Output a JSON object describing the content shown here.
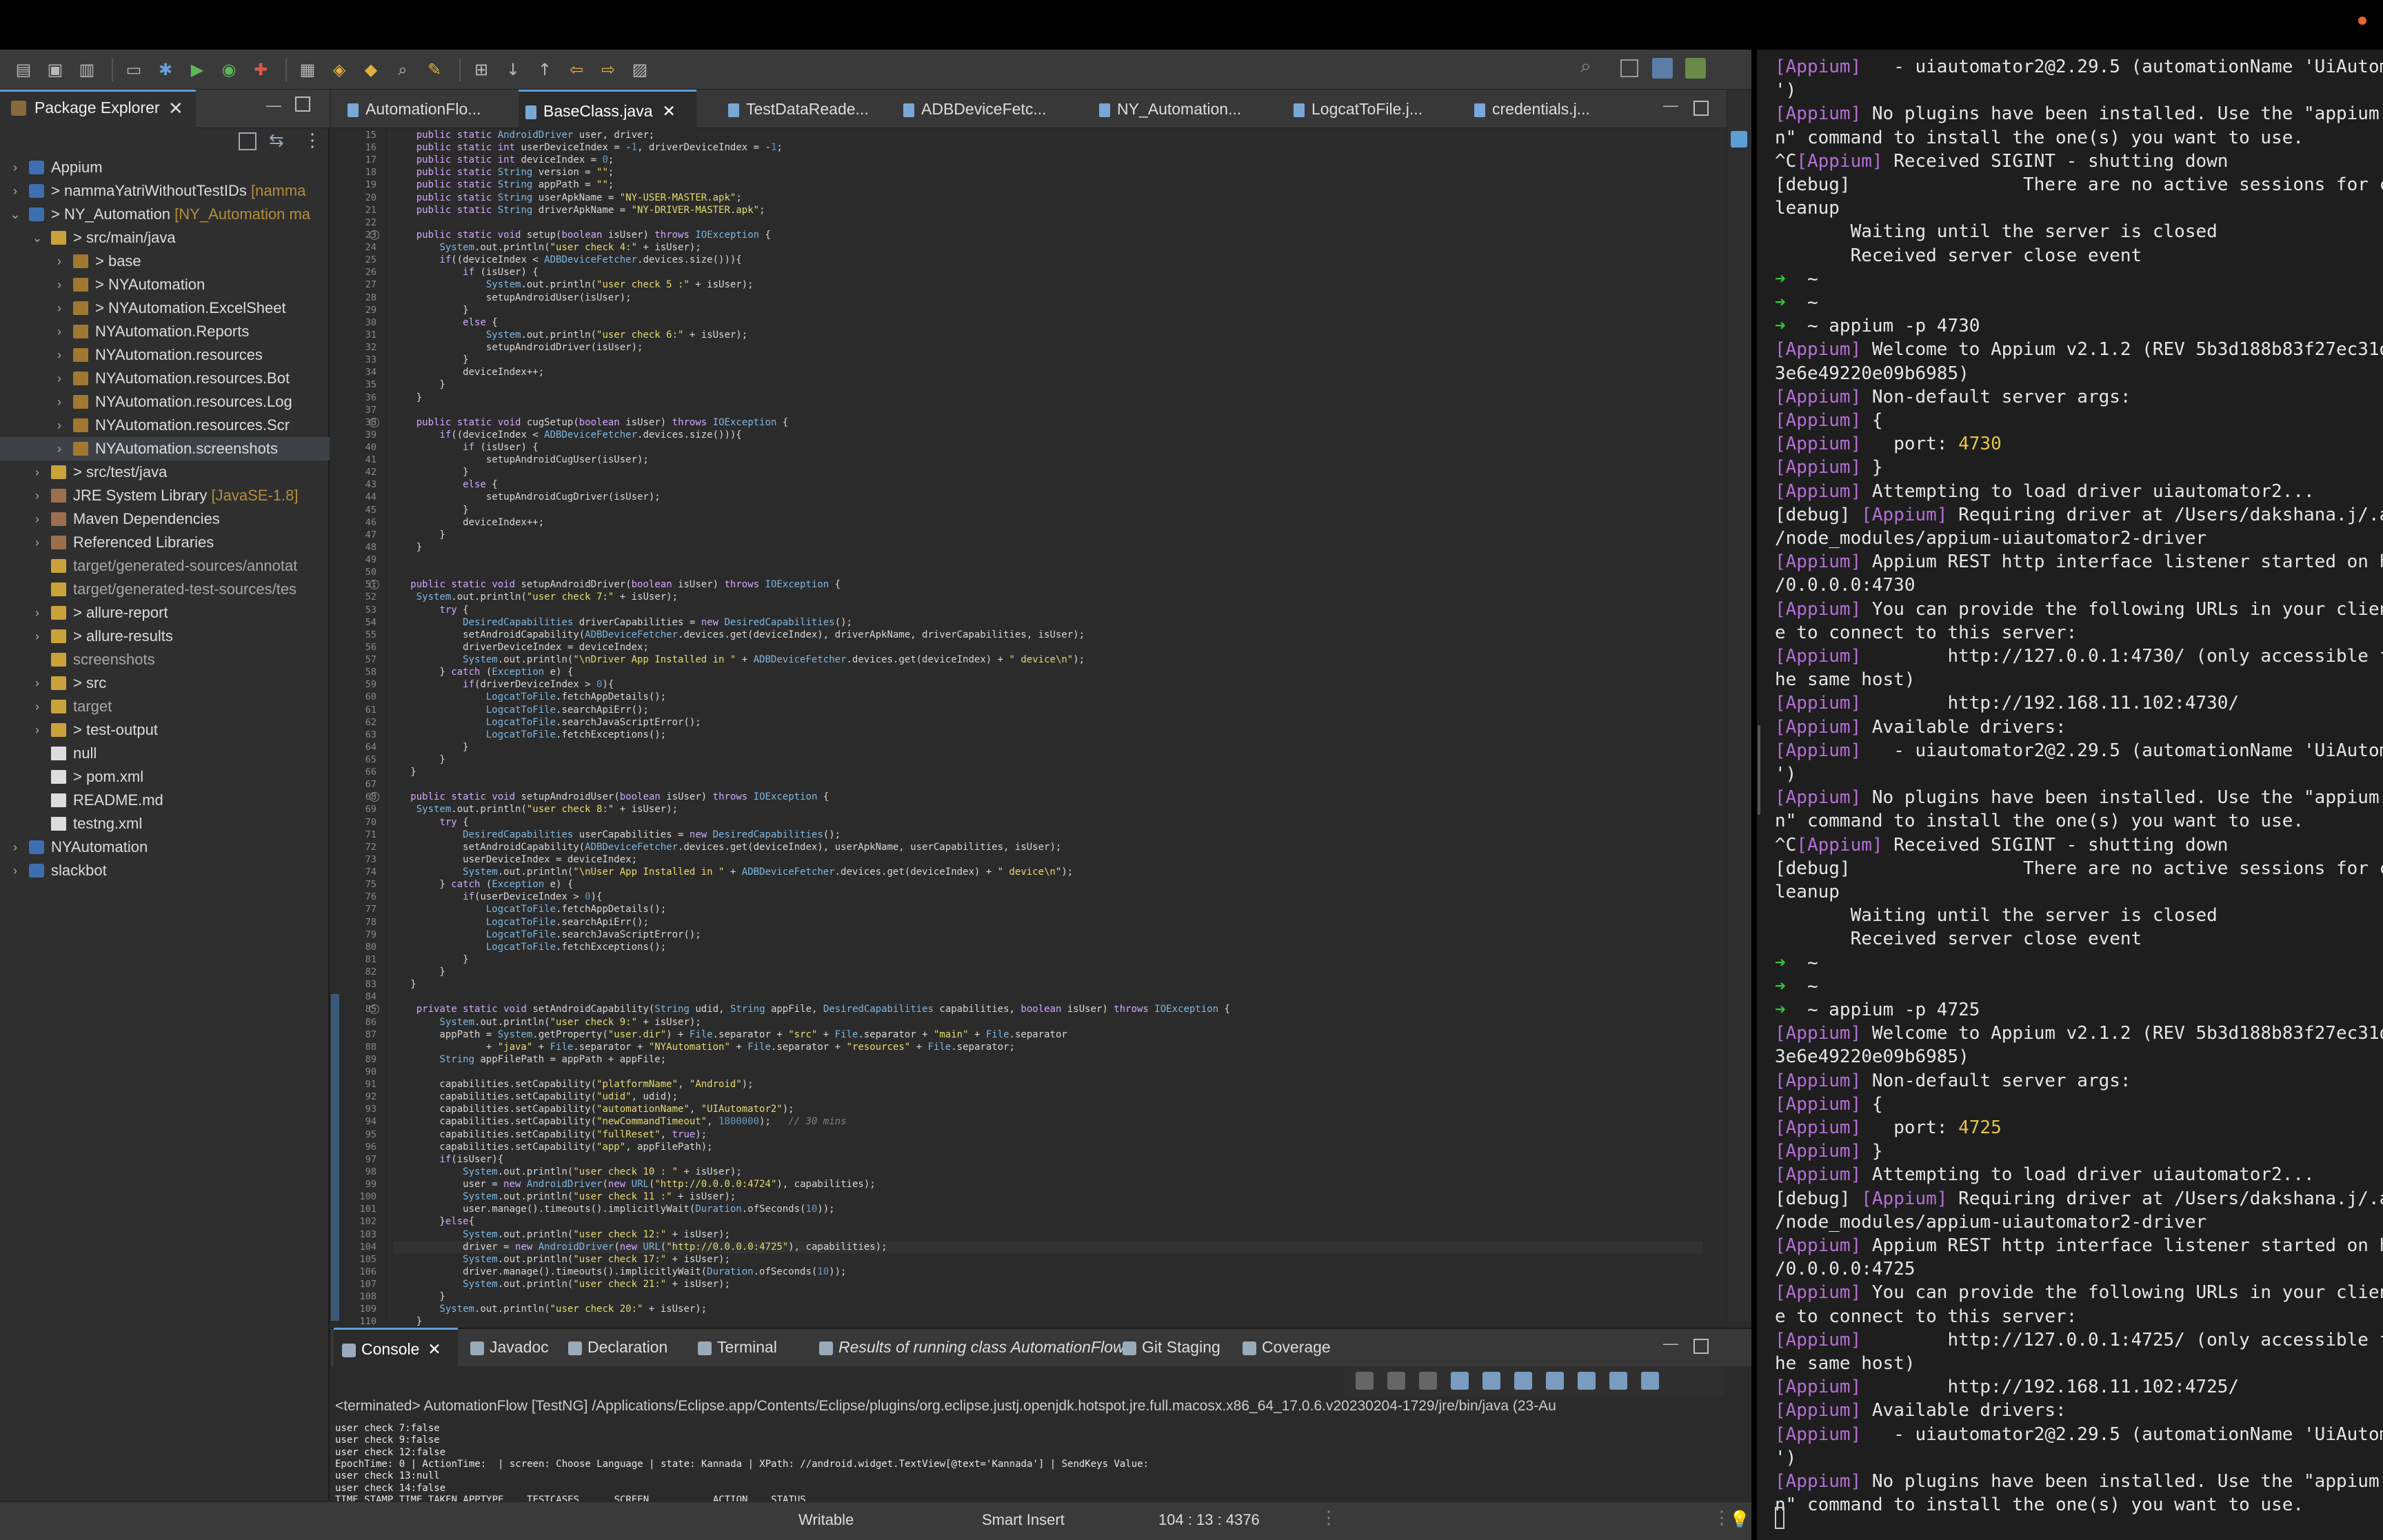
{
  "toolbar": {
    "icons": [
      "new-icon",
      "save-icon",
      "save-all-icon",
      "terminal-icon",
      "debug-icon",
      "run-icon",
      "coverage-icon",
      "external-tools-icon",
      "new-java-project-icon",
      "new-package-icon",
      "new-class-icon",
      "open-type-icon",
      "search-icon",
      "toggle-mark-icon",
      "next-annotation-icon",
      "prev-annotation-icon",
      "back-icon",
      "forward-icon",
      "perspective-icon"
    ]
  },
  "package_explorer": {
    "title": "Package Explorer",
    "items": [
      {
        "label": "Appium",
        "suffix": "",
        "indent": 0,
        "chev": ">",
        "icon": "proj"
      },
      {
        "label": "> nammaYatriWithoutTestIDs",
        "suffix": " [namma",
        "indent": 0,
        "chev": ">",
        "icon": "proj"
      },
      {
        "label": "> NY_Automation",
        "suffix": " [NY_Automation ma",
        "indent": 0,
        "chev": "v",
        "icon": "proj"
      },
      {
        "label": "> src/main/java",
        "suffix": "",
        "indent": 1,
        "chev": "v",
        "icon": "fold"
      },
      {
        "label": "> base",
        "suffix": "",
        "indent": 2,
        "chev": ">",
        "icon": "pkg"
      },
      {
        "label": "> NYAutomation",
        "suffix": "",
        "indent": 2,
        "chev": ">",
        "icon": "pkg"
      },
      {
        "label": "> NYAutomation.ExcelSheet",
        "suffix": "",
        "indent": 2,
        "chev": ">",
        "icon": "pkg"
      },
      {
        "label": "NYAutomation.Reports",
        "suffix": "",
        "indent": 2,
        "chev": ">",
        "icon": "pkg"
      },
      {
        "label": "NYAutomation.resources",
        "suffix": "",
        "indent": 2,
        "chev": ">",
        "icon": "pkg"
      },
      {
        "label": "NYAutomation.resources.Bot",
        "suffix": "",
        "indent": 2,
        "chev": ">",
        "icon": "pkg"
      },
      {
        "label": "NYAutomation.resources.Log",
        "suffix": "",
        "indent": 2,
        "chev": ">",
        "icon": "pkg"
      },
      {
        "label": "NYAutomation.resources.Scr",
        "suffix": "",
        "indent": 2,
        "chev": ">",
        "icon": "pkg"
      },
      {
        "label": "NYAutomation.screenshots",
        "suffix": "",
        "indent": 2,
        "chev": ">",
        "icon": "pkg",
        "selected": true
      },
      {
        "label": "> src/test/java",
        "suffix": "",
        "indent": 1,
        "chev": ">",
        "icon": "fold"
      },
      {
        "label": "JRE System Library",
        "suffix": " [JavaSE-1.8]",
        "indent": 1,
        "chev": ">",
        "icon": "lib"
      },
      {
        "label": "Maven Dependencies",
        "suffix": "",
        "indent": 1,
        "chev": ">",
        "icon": "lib"
      },
      {
        "label": "Referenced Libraries",
        "suffix": "",
        "indent": 1,
        "chev": ">",
        "icon": "lib"
      },
      {
        "label": "target/generated-sources/annotat",
        "suffix": "",
        "indent": 1,
        "chev": "",
        "icon": "fold",
        "dim": true
      },
      {
        "label": "target/generated-test-sources/tes",
        "suffix": "",
        "indent": 1,
        "chev": "",
        "icon": "fold",
        "dim": true
      },
      {
        "label": "> allure-report",
        "suffix": "",
        "indent": 1,
        "chev": ">",
        "icon": "fold"
      },
      {
        "label": "> allure-results",
        "suffix": "",
        "indent": 1,
        "chev": ">",
        "icon": "fold"
      },
      {
        "label": "screenshots",
        "suffix": "",
        "indent": 1,
        "chev": "",
        "icon": "fold",
        "dim": true
      },
      {
        "label": "> src",
        "suffix": "",
        "indent": 1,
        "chev": ">",
        "icon": "fold"
      },
      {
        "label": "target",
        "suffix": "",
        "indent": 1,
        "chev": ">",
        "icon": "fold",
        "dim": true
      },
      {
        "label": "> test-output",
        "suffix": "",
        "indent": 1,
        "chev": ">",
        "icon": "fold"
      },
      {
        "label": "null",
        "suffix": "",
        "indent": 1,
        "chev": "",
        "icon": "file"
      },
      {
        "label": "> pom.xml",
        "suffix": "",
        "indent": 1,
        "chev": "",
        "icon": "file"
      },
      {
        "label": "README.md",
        "suffix": "",
        "indent": 1,
        "chev": "",
        "icon": "file"
      },
      {
        "label": "testng.xml",
        "suffix": "",
        "indent": 1,
        "chev": "",
        "icon": "file"
      },
      {
        "label": "NYAutomation",
        "suffix": "",
        "indent": 0,
        "chev": ">",
        "icon": "proj"
      },
      {
        "label": "slackbot",
        "suffix": "",
        "indent": 0,
        "chev": ">",
        "icon": "proj"
      }
    ]
  },
  "editor_tabs": [
    {
      "label": "AutomationFlo...",
      "active": false
    },
    {
      "label": "BaseClass.java",
      "active": true
    },
    {
      "label": "TestDataReade...",
      "active": false
    },
    {
      "label": "ADBDeviceFetc...",
      "active": false
    },
    {
      "label": "NY_Automation...",
      "active": false
    },
    {
      "label": "LogcatToFile.j...",
      "active": false
    },
    {
      "label": "credentials.j...",
      "active": false
    }
  ],
  "code": {
    "first_line": 15,
    "cursor_line": 104,
    "fold_lines": [
      23,
      38,
      51,
      68,
      85
    ],
    "lines": [
      "    public static AndroidDriver user, driver;",
      "    public static int userDeviceIndex = -1, driverDeviceIndex = -1;",
      "    public static int deviceIndex = 0;",
      "    public static String version = \"\";",
      "    public static String appPath = \"\";",
      "    public static String userApkName = \"NY-USER-MASTER.apk\";",
      "    public static String driverApkName = \"NY-DRIVER-MASTER.apk\";",
      "",
      "    public static void setup(boolean isUser) throws IOException {",
      "        System.out.println(\"user check 4:\" + isUser);",
      "        if((deviceIndex < ADBDeviceFetcher.devices.size())){",
      "            if (isUser) {",
      "                System.out.println(\"user check 5 :\" + isUser);",
      "                setupAndroidUser(isUser);",
      "            }",
      "            else {",
      "                System.out.println(\"user check 6:\" + isUser);",
      "                setupAndroidDriver(isUser);",
      "            }",
      "            deviceIndex++;",
      "        }",
      "    }",
      "",
      "    public static void cugSetup(boolean isUser) throws IOException {",
      "        if((deviceIndex < ADBDeviceFetcher.devices.size())){",
      "            if (isUser) {",
      "                setupAndroidCugUser(isUser);",
      "            }",
      "            else {",
      "                setupAndroidCugDriver(isUser);",
      "            }",
      "            deviceIndex++;",
      "        }",
      "    }",
      "",
      "",
      "   public static void setupAndroidDriver(boolean isUser) throws IOException {",
      "    System.out.println(\"user check 7:\" + isUser);",
      "        try {",
      "            DesiredCapabilities driverCapabilities = new DesiredCapabilities();",
      "            setAndroidCapability(ADBDeviceFetcher.devices.get(deviceIndex), driverApkName, driverCapabilities, isUser);",
      "            driverDeviceIndex = deviceIndex;",
      "            System.out.println(\"\\nDriver App Installed in \" + ADBDeviceFetcher.devices.get(deviceIndex) + \" device\\n\");",
      "        } catch (Exception e) {",
      "            if(driverDeviceIndex > 0){",
      "                LogcatToFile.fetchAppDetails();",
      "                LogcatToFile.searchApiErr();",
      "                LogcatToFile.searchJavaScriptError();",
      "                LogcatToFile.fetchExceptions();",
      "            }",
      "        }",
      "   }",
      "",
      "   public static void setupAndroidUser(boolean isUser) throws IOException {",
      "    System.out.println(\"user check 8:\" + isUser);",
      "        try {",
      "            DesiredCapabilities userCapabilities = new DesiredCapabilities();",
      "            setAndroidCapability(ADBDeviceFetcher.devices.get(deviceIndex), userApkName, userCapabilities, isUser);",
      "            userDeviceIndex = deviceIndex;",
      "            System.out.println(\"\\nUser App Installed in \" + ADBDeviceFetcher.devices.get(deviceIndex) + \" device\\n\");",
      "        } catch (Exception e) {",
      "            if(userDeviceIndex > 0){",
      "                LogcatToFile.fetchAppDetails();",
      "                LogcatToFile.searchApiErr();",
      "                LogcatToFile.searchJavaScriptError();",
      "                LogcatToFile.fetchExceptions();",
      "            }",
      "        }",
      "   }",
      "",
      "    private static void setAndroidCapability(String udid, String appFile, DesiredCapabilities capabilities, boolean isUser) throws IOException {",
      "        System.out.println(\"user check 9:\" + isUser);",
      "        appPath = System.getProperty(\"user.dir\") + File.separator + \"src\" + File.separator + \"main\" + File.separator",
      "                + \"java\" + File.separator + \"NYAutomation\" + File.separator + \"resources\" + File.separator;",
      "        String appFilePath = appPath + appFile;",
      "",
      "        capabilities.setCapability(\"platformName\", \"Android\");",
      "        capabilities.setCapability(\"udid\", udid);",
      "        capabilities.setCapability(\"automationName\", \"UIAutomator2\");",
      "        capabilities.setCapability(\"newCommandTimeout\", 1800000);   // 30 mins",
      "        capabilities.setCapability(\"fullReset\", true);",
      "        capabilities.setCapability(\"app\", appFilePath);",
      "        if(isUser){",
      "            System.out.println(\"user check 10 : \" + isUser);",
      "            user = new AndroidDriver(new URL(\"http://0.0.0.0:4724\"), capabilities);",
      "            System.out.println(\"user check 11 :\" + isUser);",
      "            user.manage().timeouts().implicitlyWait(Duration.ofSeconds(10));",
      "        }else{",
      "            System.out.println(\"user check 12:\" + isUser);",
      "            driver = new AndroidDriver(new URL(\"http://0.0.0.0:4725\"), capabilities);",
      "            System.out.println(\"user check 17:\" + isUser);",
      "            driver.manage().timeouts().implicitlyWait(Duration.ofSeconds(10));",
      "            System.out.println(\"user check 21:\" + isUser);",
      "        }",
      "        System.out.println(\"user check 20:\" + isUser);",
      "    }"
    ]
  },
  "console_tabs": [
    {
      "label": "Console",
      "active": true
    },
    {
      "label": "Javadoc",
      "active": false
    },
    {
      "label": "Declaration",
      "active": false
    },
    {
      "label": "Terminal",
      "active": false
    },
    {
      "label": "Results of running class AutomationFlow",
      "active": false
    },
    {
      "label": "Git Staging",
      "active": false
    },
    {
      "label": "Coverage",
      "active": false
    }
  ],
  "console": {
    "terminated": "<terminated> AutomationFlow [TestNG] /Applications/Eclipse.app/Contents/Eclipse/plugins/org.eclipse.justj.openjdk.hotspot.jre.full.macosx.x86_64_17.0.6.v20230204-1729/jre/bin/java  (23-Au",
    "lines": [
      "user check 7:false",
      "user check 9:false",
      "user check 12:false",
      "EpochTime: 0 | ActionTime:  | screen: Choose Language | state: Kannada | XPath: //android.widget.TextView[@text='Kannada'] | SendKeys Value:",
      "user check 13:null",
      "user check 14:false",
      "TIME STAMP TIME TAKEN APPTYPE    TESTCASES      SCREEN           ACTION    STATUS"
    ]
  },
  "statusbar": {
    "writable": "Writable",
    "insert": "Smart Insert",
    "position": "104 : 13 : 4376"
  },
  "terminal": {
    "lines": [
      {
        "tag": "[Appium]",
        "text": "   - uiautomator2@2.29.5 (automationName 'UiAutomator2"
      },
      {
        "tag": "",
        "text": "')"
      },
      {
        "tag": "[Appium]",
        "text": " No plugins have been installed. Use the \"appium plugi"
      },
      {
        "tag": "",
        "text": "n\" command to install the one(s) you want to use."
      },
      {
        "tag": "^C[Appium]",
        "text": " Received SIGINT - shutting down"
      },
      {
        "tag": "",
        "text": "[debug]                There are no active sessions for c"
      },
      {
        "tag": "",
        "text": "leanup"
      },
      {
        "tag": "",
        "text": "       Waiting until the server is closed"
      },
      {
        "tag": "",
        "text": "       Received server close event"
      },
      {
        "tag": "➜",
        "text": "  ~"
      },
      {
        "tag": "➜",
        "text": "  ~"
      },
      {
        "tag": "➜",
        "text": "  ~ appium -p 4730"
      },
      {
        "tag": "[Appium]",
        "text": " Welcome to Appium v2.1.2 (REV 5b3d188b83f27ec31d97f3f"
      },
      {
        "tag": "",
        "text": "3e6e49220e09b6985)"
      },
      {
        "tag": "[Appium]",
        "text": " Non-default server args:"
      },
      {
        "tag": "[Appium]",
        "text": " {"
      },
      {
        "tag": "[Appium]",
        "text": "   port: ",
        "port": "4730"
      },
      {
        "tag": "[Appium]",
        "text": " }"
      },
      {
        "tag": "[Appium]",
        "text": " Attempting to load driver uiautomator2..."
      },
      {
        "tag": "[debug] [Appium]",
        "text": " Requiring driver at /Users/dakshana.j/.appium"
      },
      {
        "tag": "",
        "text": "/node_modules/appium-uiautomator2-driver"
      },
      {
        "tag": "[Appium]",
        "text": " Appium REST http interface listener started on http:/"
      },
      {
        "tag": "",
        "text": "/0.0.0.0:4730"
      },
      {
        "tag": "[Appium]",
        "text": " You can provide the following URLs in your client cod"
      },
      {
        "tag": "",
        "text": "e to connect to this server:"
      },
      {
        "tag": "[Appium]",
        "text": "        http://127.0.0.1:4730/ (only accessible from t"
      },
      {
        "tag": "",
        "text": "he same host)"
      },
      {
        "tag": "[Appium]",
        "text": "        http://192.168.11.102:4730/"
      },
      {
        "tag": "[Appium]",
        "text": " Available drivers:"
      },
      {
        "tag": "[Appium]",
        "text": "   - uiautomator2@2.29.5 (automationName 'UiAutomator2"
      },
      {
        "tag": "",
        "text": "')"
      },
      {
        "tag": "[Appium]",
        "text": " No plugins have been installed. Use the \"appium plugi"
      },
      {
        "tag": "",
        "text": "n\" command to install the one(s) you want to use."
      },
      {
        "tag": "^C[Appium]",
        "text": " Received SIGINT - shutting down"
      },
      {
        "tag": "",
        "text": "[debug]                There are no active sessions for c"
      },
      {
        "tag": "",
        "text": "leanup"
      },
      {
        "tag": "",
        "text": "       Waiting until the server is closed"
      },
      {
        "tag": "",
        "text": "       Received server close event"
      },
      {
        "tag": "➜",
        "text": "  ~"
      },
      {
        "tag": "➜",
        "text": "  ~"
      },
      {
        "tag": "➜",
        "text": "  ~ appium -p 4725"
      },
      {
        "tag": "[Appium]",
        "text": " Welcome to Appium v2.1.2 (REV 5b3d188b83f27ec31d97f3f"
      },
      {
        "tag": "",
        "text": "3e6e49220e09b6985)"
      },
      {
        "tag": "[Appium]",
        "text": " Non-default server args:"
      },
      {
        "tag": "[Appium]",
        "text": " {"
      },
      {
        "tag": "[Appium]",
        "text": "   port: ",
        "port": "4725"
      },
      {
        "tag": "[Appium]",
        "text": " }"
      },
      {
        "tag": "[Appium]",
        "text": " Attempting to load driver uiautomator2..."
      },
      {
        "tag": "[debug] [Appium]",
        "text": " Requiring driver at /Users/dakshana.j/.appium"
      },
      {
        "tag": "",
        "text": "/node_modules/appium-uiautomator2-driver"
      },
      {
        "tag": "[Appium]",
        "text": " Appium REST http interface listener started on http:/"
      },
      {
        "tag": "",
        "text": "/0.0.0.0:4725"
      },
      {
        "tag": "[Appium]",
        "text": " You can provide the following URLs in your client cod"
      },
      {
        "tag": "",
        "text": "e to connect to this server:"
      },
      {
        "tag": "[Appium]",
        "text": "        http://127.0.0.1:4725/ (only accessible from t"
      },
      {
        "tag": "",
        "text": "he same host)"
      },
      {
        "tag": "[Appium]",
        "text": "        http://192.168.11.102:4725/"
      },
      {
        "tag": "[Appium]",
        "text": " Available drivers:"
      },
      {
        "tag": "[Appium]",
        "text": "   - uiautomator2@2.29.5 (automationName 'UiAutomator2"
      },
      {
        "tag": "",
        "text": "')"
      },
      {
        "tag": "[Appium]",
        "text": " No plugins have been installed. Use the \"appium plugi"
      },
      {
        "tag": "",
        "text": "n\" command to install the one(s) you want to use."
      }
    ]
  }
}
